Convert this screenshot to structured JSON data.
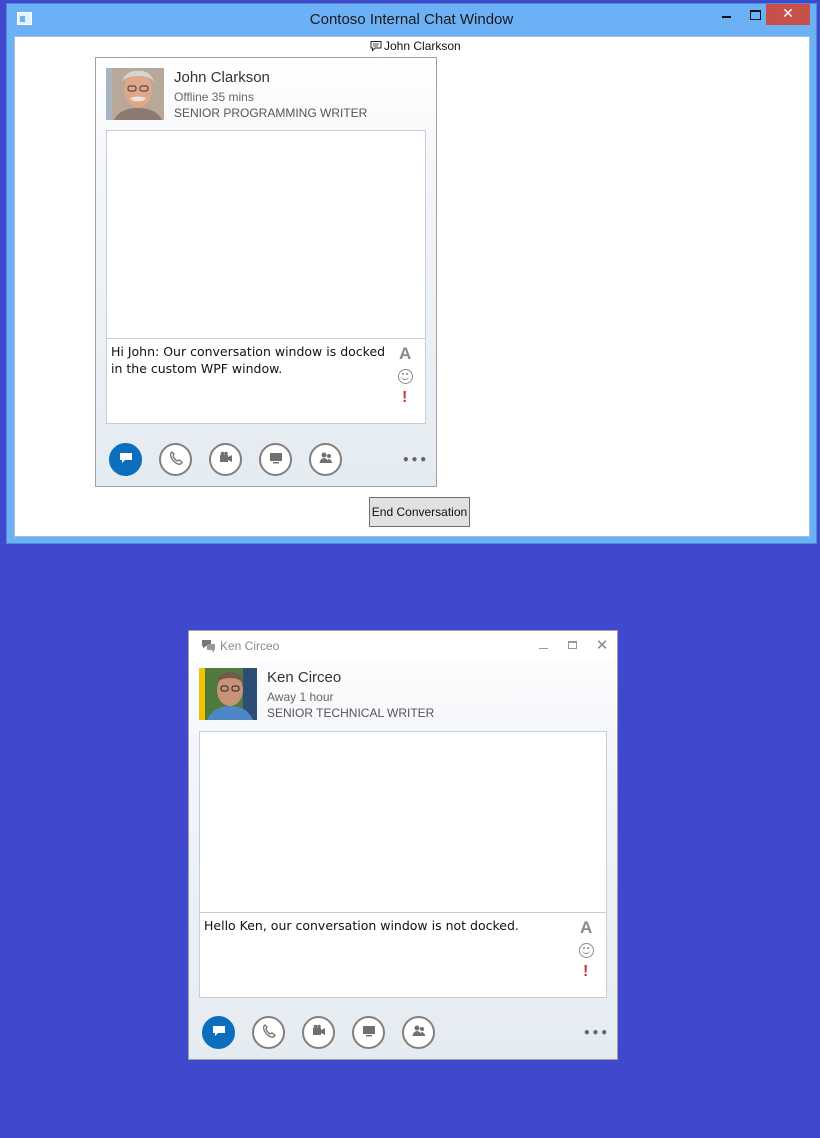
{
  "host_window": {
    "title": "Contoso Internal Chat Window",
    "close_glyph": "✕",
    "caption": "John Clarkson",
    "end_button_label": "End Conversation"
  },
  "docked_conversation": {
    "contact": {
      "name": "John Clarkson",
      "status": "Offline 35 mins",
      "job_title": "SENIOR PROGRAMMING WRITER"
    },
    "message_draft": "Hi John: Our conversation window is docked in the custom WPF window.",
    "font_glyph": "A",
    "priority_glyph": "!",
    "more_label": "•••"
  },
  "floating_conversation": {
    "window_title": "Ken Circeo",
    "close_glyph": "✕",
    "contact": {
      "name": "Ken Circeo",
      "status": "Away 1 hour",
      "job_title": "SENIOR TECHNICAL WRITER"
    },
    "message_draft": "Hello Ken, our conversation window is not docked.",
    "font_glyph": "A",
    "priority_glyph": "!",
    "more_label": "•••"
  },
  "toolbar_icons": [
    "im-icon",
    "phone-icon",
    "video-icon",
    "present-icon",
    "people-icon"
  ],
  "colors": {
    "desktop": "#4049cd",
    "host_frame": "#6cb0f6",
    "close_button": "#c7504a",
    "im_active": "#0d6ebe",
    "presence_away": "#f2c200",
    "priority": "#d13438"
  }
}
